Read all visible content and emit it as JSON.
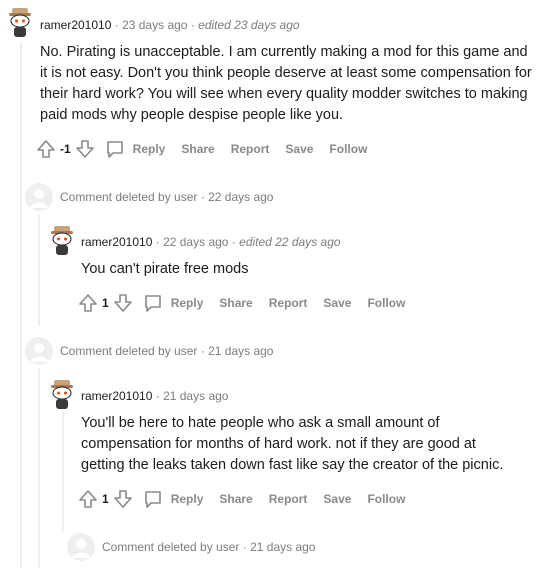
{
  "colors": {
    "thread_line": "#edeff1",
    "meta": "#7c7c7c",
    "action": "#878a8c",
    "text": "#1c1c1c",
    "avatar_accent": "#ff4500"
  },
  "comments": [
    {
      "username": "ramer201010",
      "time": "23 days ago",
      "edited": "edited 23 days ago",
      "body": "No. Pirating is unacceptable. I am currently making a mod for this game and it is not easy. Don't you think people deserve at least some compensation for their hard work? You will see when every quality modder switches to making paid mods why people despise people like you.",
      "score": "-1"
    },
    {
      "deleted_text": "Comment deleted by user",
      "time": "22 days ago"
    },
    {
      "username": "ramer201010",
      "time": "22 days ago",
      "edited": "edited 22 days ago",
      "body": "You can't pirate free mods",
      "score": "1"
    },
    {
      "deleted_text": "Comment deleted by user",
      "time": "21 days ago"
    },
    {
      "username": "ramer201010",
      "time": "21 days ago",
      "body": "You'll be here to hate people who ask a small amount of compensation for months of hard work. not if they are good at getting the leaks taken down fast like say the creator of the picnic.",
      "score": "1"
    },
    {
      "deleted_text": "Comment deleted by user",
      "time": "21 days ago"
    }
  ],
  "actions": {
    "reply": "Reply",
    "share": "Share",
    "report": "Report",
    "save": "Save",
    "follow": "Follow"
  },
  "separator": "·",
  "icons": {
    "upvote": "upvote-arrow-icon",
    "downvote": "downvote-arrow-icon",
    "reply": "speech-bubble-icon",
    "avatar": "snoo-avatar-icon",
    "deleted_avatar": "ghost-avatar-icon"
  }
}
